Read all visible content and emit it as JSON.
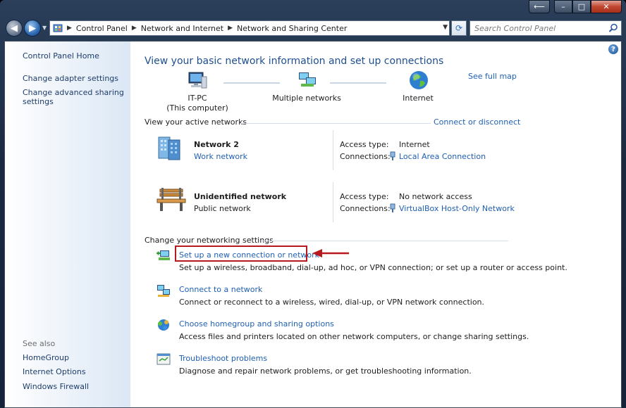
{
  "window": {
    "caption": {
      "min": "–",
      "max": "□",
      "close": "✕",
      "back": "⟵"
    }
  },
  "nav": {
    "breadcrumb": [
      "Control Panel",
      "Network and Internet",
      "Network and Sharing Center"
    ],
    "search_placeholder": "Search Control Panel"
  },
  "sidebar": {
    "home": "Control Panel Home",
    "links": [
      "Change adapter settings",
      "Change advanced sharing settings"
    ],
    "see_also_heading": "See also",
    "see_also": [
      "HomeGroup",
      "Internet Options",
      "Windows Firewall"
    ]
  },
  "main": {
    "title": "View your basic network information and set up connections",
    "see_full_map": "See full map",
    "map": {
      "computer_name": "IT-PC",
      "computer_sub": "(This computer)",
      "middle": "Multiple networks",
      "internet": "Internet"
    },
    "active_heading": "View your active networks",
    "connect_disconnect": "Connect or disconnect",
    "networks": [
      {
        "name": "Network  2",
        "type": "Work network",
        "access_label": "Access type:",
        "access_value": "Internet",
        "conn_label": "Connections:",
        "conn_value": "Local Area Connection"
      },
      {
        "name": "Unidentified network",
        "type": "Public network",
        "access_label": "Access type:",
        "access_value": "No network access",
        "conn_label": "Connections:",
        "conn_value": "VirtualBox Host-Only Network"
      }
    ],
    "settings_heading": "Change your networking settings",
    "tasks": [
      {
        "link": "Set up a new connection or network",
        "desc": "Set up a wireless, broadband, dial-up, ad hoc, or VPN connection; or set up a router or access point."
      },
      {
        "link": "Connect to a network",
        "desc": "Connect or reconnect to a wireless, wired, dial-up, or VPN network connection."
      },
      {
        "link": "Choose homegroup and sharing options",
        "desc": "Access files and printers located on other network computers, or change sharing settings."
      },
      {
        "link": "Troubleshoot problems",
        "desc": "Diagnose and repair network problems, or get troubleshooting information."
      }
    ],
    "help": "?"
  },
  "colors": {
    "link": "#1f5fb3",
    "title": "#1e4f8f",
    "highlight": "#b7191c"
  }
}
